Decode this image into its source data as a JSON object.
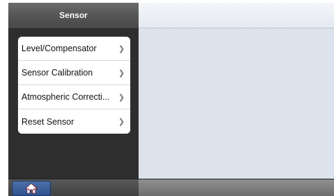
{
  "sidebar": {
    "title": "Sensor",
    "items": [
      {
        "label": "Level/Compensator"
      },
      {
        "label": "Sensor Calibration"
      },
      {
        "label": "Atmospheric Correcti..."
      },
      {
        "label": "Reset Sensor"
      }
    ]
  },
  "icons": {
    "chevron": "chevron-right-icon",
    "home": "home-icon"
  },
  "colors": {
    "content_background": "#dde3ec",
    "sidebar_background": "#2e2e2e",
    "home_button": "#2f5390"
  }
}
